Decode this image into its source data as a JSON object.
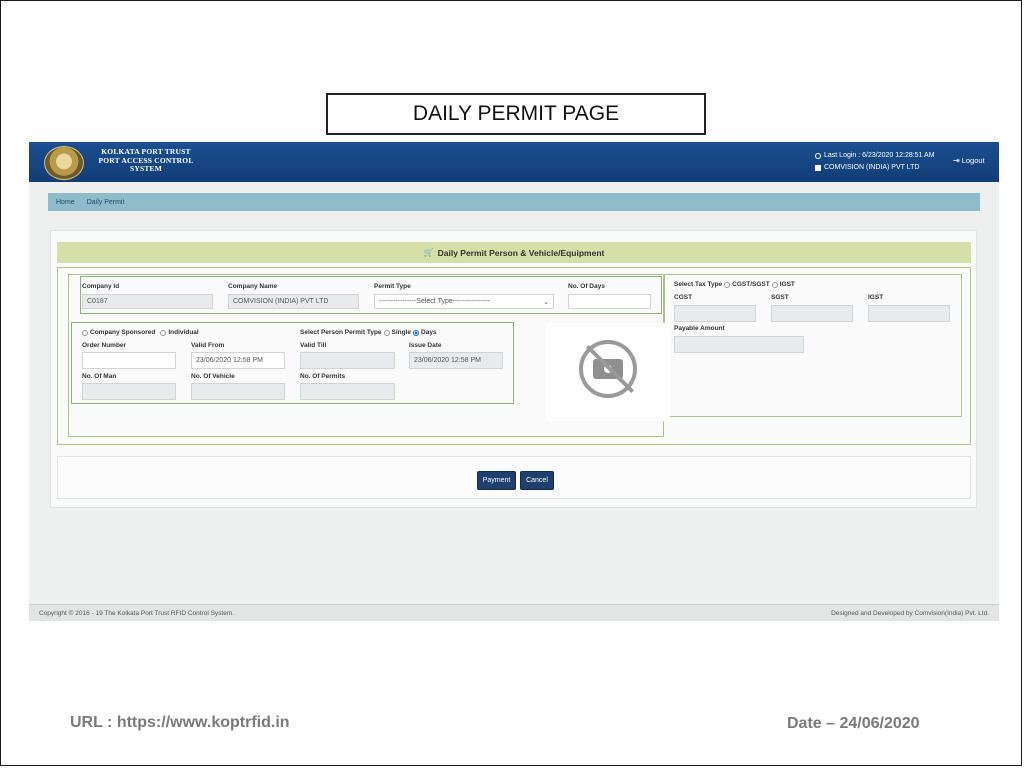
{
  "slide": {
    "title": "DAILY PERMIT PAGE",
    "url": "URL : https://www.koptrfid.in",
    "date": "Date – 24/06/2020"
  },
  "header": {
    "logo_line1": "KOLKATA PORT TRUST",
    "logo_line2": "PORT ACCESS CONTROL",
    "logo_line3": "SYSTEM",
    "last_login": "Last Login : 6/23/2020 12:28:51 AM",
    "company": "COMVISION (INDIA) PVT LTD",
    "logout": "Logout"
  },
  "breadcrumb": {
    "home": "Home",
    "current": "Daily Permit"
  },
  "panel": {
    "title": "Daily Permit Person & Vehicle/Equipment"
  },
  "form": {
    "company_id_label": "Company Id",
    "company_id_value": "C0187",
    "company_name_label": "Company Name",
    "company_name_value": "COMVISION (INDIA) PVT LTD",
    "permit_type_label": "Permit Type",
    "permit_type_value": "----------------Select Type----------------",
    "no_of_days_label": "No. Of Days",
    "no_of_days_value": "",
    "company_sponsored": "Company Sponsored",
    "individual": "Individual",
    "select_person_permit_type": "Select Person Permit Type",
    "single": "Single",
    "days": "Days",
    "order_number_label": "Order Number",
    "order_number_value": "",
    "valid_from_label": "Valid From",
    "valid_from_value": "23/06/2020 12:58 PM",
    "valid_till_label": "Valid Till",
    "valid_till_value": "",
    "issue_date_label": "Issue Date",
    "issue_date_value": "23/06/2020 12:58 PM",
    "no_of_man_label": "No. Of Man",
    "no_of_man_value": "",
    "no_of_vehicle_label": "No. Of Vehicle",
    "no_of_vehicle_value": "",
    "no_of_permits_label": "No. Of Permits",
    "no_of_permits_value": ""
  },
  "tax": {
    "select_tax_type": "Select Tax Type",
    "cgst_sgst": "CGST/SGST",
    "igst_option": "IGST",
    "cgst_label": "CGST",
    "sgst_label": "SGST",
    "igst_label": "IGST",
    "payable_amount_label": "Payable Amount"
  },
  "buttons": {
    "payment": "Payment",
    "cancel": "Cancel"
  },
  "footer": {
    "left": "Copyright © 2016 - 19 The Kolkata Port Trust RFID Control System.",
    "right": "Designed and Developed by Comvision(India) Pvt. Ltd."
  },
  "colors": {
    "header_blue": "#1b4f90",
    "breadcrumb": "#8fbccb",
    "panel_head": "#d6dfa7",
    "button": "#1f3f6f"
  }
}
